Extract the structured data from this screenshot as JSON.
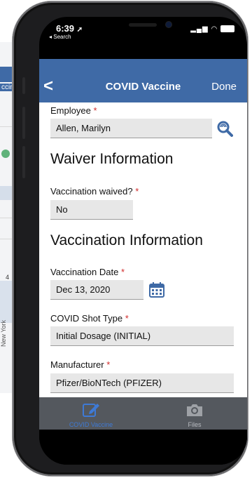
{
  "background_app": {
    "header_fragment": "ccin",
    "row_number": "4",
    "rotated_label": "New York"
  },
  "status_bar": {
    "time": "6:39",
    "back_label": "◂ Search",
    "icons": [
      "location-arrow-icon",
      "signal-icon",
      "wifi-icon",
      "battery-icon"
    ]
  },
  "navbar": {
    "back_icon": "chevron-left-icon",
    "title": "COVID Vaccine",
    "done_label": "Done",
    "color": "#3f6aa6"
  },
  "form": {
    "employee": {
      "label": "Employee",
      "required_mark": "*",
      "value": "Allen, Marilyn",
      "lookup_icon": "search-icon"
    },
    "waiver_section": "Waiver Information",
    "vaccination_waived": {
      "label": "Vaccination waived?",
      "required_mark": "*",
      "value": "No"
    },
    "vaccination_section": "Vaccination Information",
    "vaccination_date": {
      "label": "Vaccination Date",
      "required_mark": "*",
      "value": "Dec 13, 2020",
      "calendar_icon": "calendar-icon"
    },
    "shot_type": {
      "label": "COVID Shot Type",
      "required_mark": "*",
      "value": "Initial Dosage (INITIAL)"
    },
    "manufacturer": {
      "label": "Manufacturer",
      "required_mark": "*",
      "value": "Pfizer/BioNTech (PFIZER)"
    }
  },
  "tabbar": {
    "tabs": [
      {
        "label": "COVID Vaccine",
        "icon": "edit-icon",
        "active": true
      },
      {
        "label": "Files",
        "icon": "camera-icon",
        "active": false
      }
    ],
    "active_color": "#3e7ad6"
  }
}
